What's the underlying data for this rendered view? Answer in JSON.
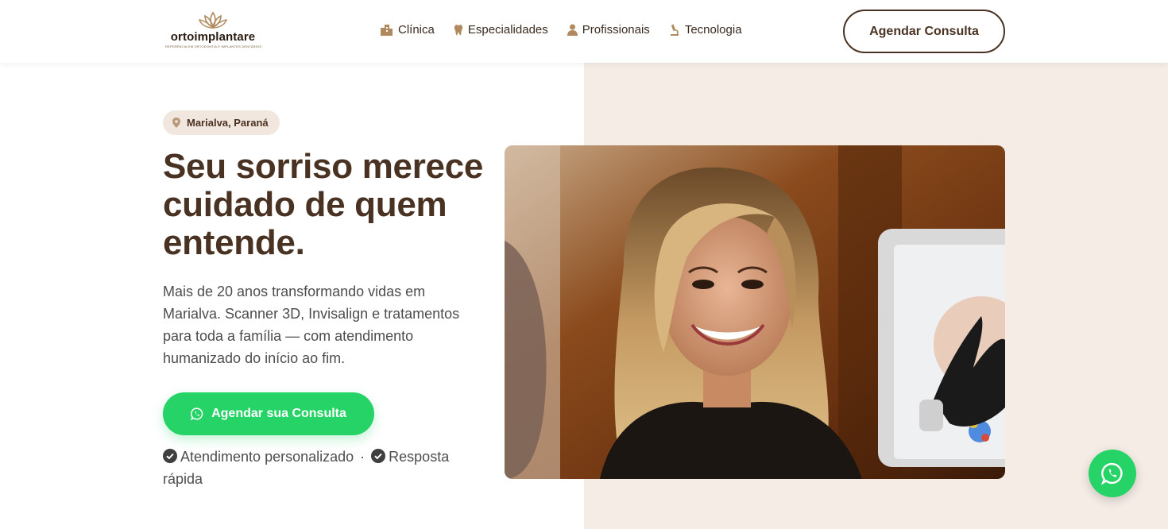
{
  "brand": {
    "name": "ortoimplantare",
    "tagline": "REFERÊNCIA EM ORTODONTIA E IMPLANTES DENTÁRIOS"
  },
  "nav": {
    "items": [
      {
        "label": "Clínica",
        "icon": "building-icon"
      },
      {
        "label": "Especialidades",
        "icon": "tooth-icon"
      },
      {
        "label": "Profissionais",
        "icon": "person-icon"
      },
      {
        "label": "Tecnologia",
        "icon": "microscope-icon"
      }
    ],
    "cta_label": "Agendar Consulta"
  },
  "hero": {
    "location": "Marialva, Paraná",
    "headline": "Seu sorriso merece cuidado de quem entende.",
    "lead": "Mais de 20 anos transformando vidas em Marialva. Scanner 3D, Invisalign e tratamentos para toda a família — com atendimento humanizado do início ao fim.",
    "cta_label": "Agendar sua Consulta",
    "features": [
      "Atendimento personalizado",
      "Resposta rápida"
    ],
    "separator": "·"
  },
  "colors": {
    "brand_brown": "#4a3222",
    "whatsapp_green": "#25d366",
    "panel_beige": "#f4ece5",
    "badge_beige": "#f1e7de"
  }
}
